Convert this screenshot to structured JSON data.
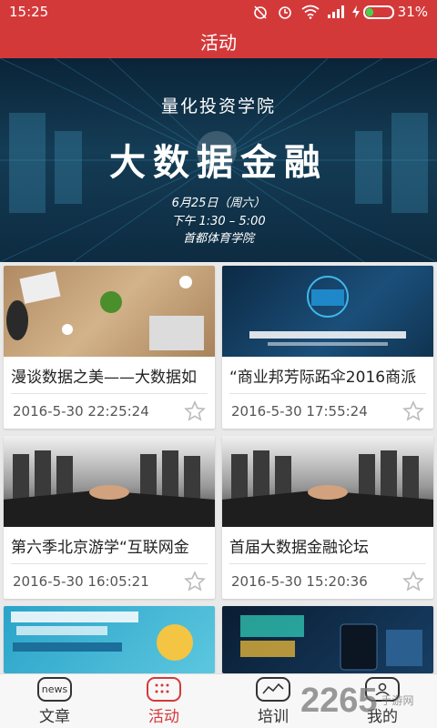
{
  "status_bar": {
    "time": "15:25",
    "battery_percent": "31%",
    "battery_level": 0.31,
    "icons": [
      "alarm-off-icon",
      "alarm-icon",
      "wifi-icon",
      "signal-icon",
      "charging-icon",
      "battery-icon"
    ]
  },
  "app_bar": {
    "title": "活动"
  },
  "banner": {
    "heading": "量化投资学院",
    "title": "大数据金融",
    "date": "6月25日（周六）",
    "time": "下午 1:30 – 5:00",
    "venue": "首都体育学院"
  },
  "cards": [
    {
      "title": "漫谈数据之美——大数据如",
      "date": "2016-5-30 22:25:24",
      "image": "office-meeting"
    },
    {
      "title": "“商业邦芳际跖伞2016商派",
      "date": "2016-5-30 17:55:24",
      "image": "shopex-event"
    },
    {
      "title": "第六季北京游学“互联网金",
      "date": "2016-5-30 16:05:21",
      "image": "handshake"
    },
    {
      "title": "首届大数据金融论坛",
      "date": "2016-5-30 15:20:36",
      "image": "handshake"
    },
    {
      "title": "",
      "date": "",
      "image": "fintech-poster"
    },
    {
      "title": "",
      "date": "",
      "image": "data-marketing-poster"
    }
  ],
  "nav": {
    "items": [
      {
        "label": "文章",
        "icon": "news-icon",
        "icon_text": "news"
      },
      {
        "label": "活动",
        "icon": "calendar-icon",
        "icon_text": ""
      },
      {
        "label": "培训",
        "icon": "training-icon",
        "icon_text": ""
      },
      {
        "label": "我的",
        "icon": "profile-icon",
        "icon_text": ""
      }
    ],
    "active_index": 1
  },
  "watermark": {
    "logo": "2265",
    "text": "手游网"
  },
  "colors": {
    "primary": "#d4393a",
    "battery": "#49d14b",
    "background": "#e9e9e9"
  }
}
